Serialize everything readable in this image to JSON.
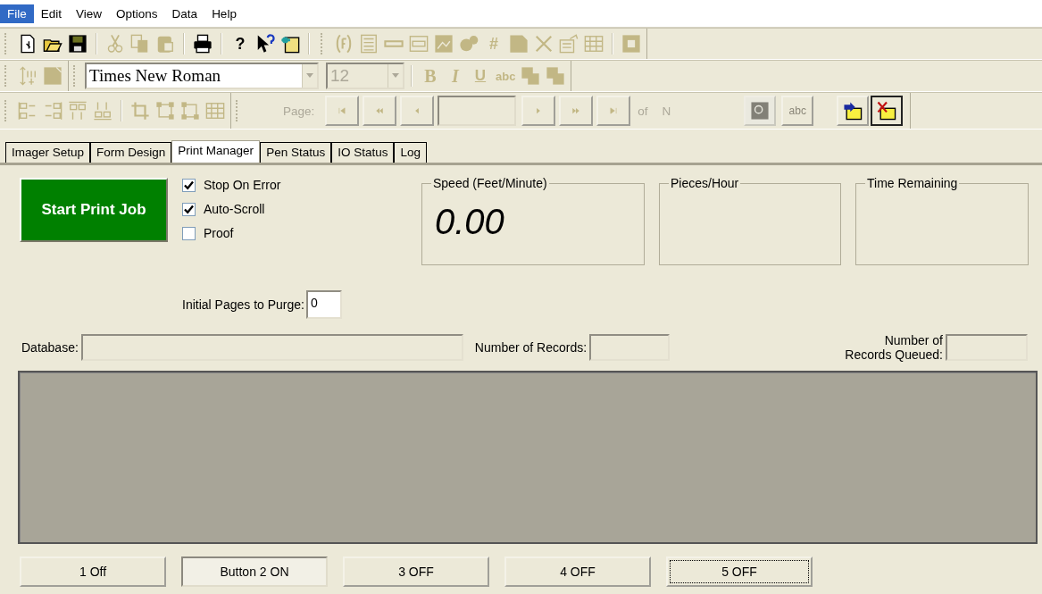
{
  "menu": [
    {
      "label": "File",
      "selected": true
    },
    {
      "label": "Edit",
      "selected": false
    },
    {
      "label": "View",
      "selected": false
    },
    {
      "label": "Options",
      "selected": false
    },
    {
      "label": "Data",
      "selected": false
    },
    {
      "label": "Help",
      "selected": false
    }
  ],
  "standard_toolbar": [
    {
      "disabled": false
    },
    {
      "disabled": false
    },
    {
      "disabled": false
    },
    {
      "disabled": true
    },
    {
      "disabled": true
    },
    {
      "disabled": true
    },
    {
      "disabled": false
    },
    {
      "glyph": "?",
      "disabled": false
    },
    {
      "disabled": false
    },
    {
      "disabled": false
    },
    {
      "disabled": true
    },
    {
      "disabled": true
    },
    {
      "disabled": true
    },
    {
      "disabled": true
    },
    {
      "disabled": true
    },
    {
      "disabled": true
    },
    {
      "glyph": "#",
      "disabled": true
    },
    {
      "disabled": true
    },
    {
      "disabled": true
    },
    {
      "disabled": true
    },
    {
      "disabled": true
    },
    {
      "disabled": true
    }
  ],
  "format_toolbar": {
    "tools": [
      {
        "disabled": true
      },
      {
        "disabled": true
      }
    ],
    "font": {
      "value": "Times New Roman"
    },
    "size": {
      "value": "12",
      "disabled": true
    },
    "styles": [
      {
        "glyph": "B",
        "disabled": true
      },
      {
        "glyph": "I",
        "disabled": true
      },
      {
        "glyph": "U",
        "disabled": true
      },
      {
        "glyph": "abc",
        "disabled": true
      },
      {
        "disabled": true
      },
      {
        "disabled": true
      }
    ]
  },
  "layout_toolbar": {
    "tools": [
      {
        "disabled": true
      },
      {
        "disabled": true
      },
      {
        "disabled": true
      },
      {
        "disabled": true
      },
      {
        "disabled": true
      },
      {
        "disabled": true
      },
      {
        "disabled": true
      },
      {
        "disabled": true
      }
    ],
    "page_label": "Page:",
    "nav": [
      {
        "disabled": true
      },
      {
        "disabled": true
      },
      {
        "disabled": true
      },
      {
        "disabled": true
      },
      {
        "disabled": true
      },
      {
        "disabled": true
      }
    ],
    "of_label": "of",
    "total": "N",
    "buttons": [
      {
        "disabled": true,
        "pressed": false
      },
      {
        "glyph": "abc",
        "disabled": true,
        "pressed": false
      },
      {
        "disabled": false,
        "pressed": false
      },
      {
        "disabled": false,
        "pressed": true
      }
    ]
  },
  "tabs": [
    {
      "label": "Imager Setup",
      "selected": false
    },
    {
      "label": "Form Design",
      "selected": false
    },
    {
      "label": "Print Manager",
      "selected": true
    },
    {
      "label": "Pen Status",
      "selected": false
    },
    {
      "label": "IO Status",
      "selected": false
    },
    {
      "label": "Log",
      "selected": false
    }
  ],
  "print_manager": {
    "start_button": "Start Print Job",
    "options": [
      {
        "label": "Stop On Error",
        "checked": true
      },
      {
        "label": "Auto-Scroll",
        "checked": true
      },
      {
        "label": "Proof",
        "checked": false
      }
    ],
    "gauges": [
      {
        "title": "Speed (Feet/Minute)",
        "value": "0.00"
      },
      {
        "title": "Pieces/Hour"
      },
      {
        "title": "Time Remaining"
      }
    ],
    "purge": {
      "label": "Initial Pages to Purge:",
      "value": "0"
    },
    "database": {
      "label": "Database:"
    },
    "records": {
      "label": "Number of Records:"
    },
    "queued": {
      "label": "Number of\nRecords Queued:"
    },
    "buttons": [
      {
        "label": "1 Off",
        "selected": false,
        "focused": false
      },
      {
        "label": "Button 2 ON",
        "selected": true,
        "focused": false
      },
      {
        "label": "3 OFF",
        "selected": false,
        "focused": false
      },
      {
        "label": "4 OFF",
        "selected": false,
        "focused": false
      },
      {
        "label": "5 OFF",
        "selected": false,
        "focused": true
      }
    ]
  }
}
